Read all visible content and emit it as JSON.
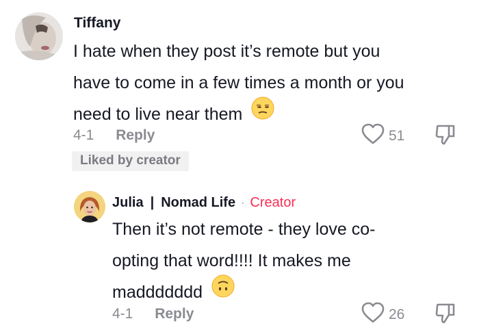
{
  "comment": {
    "author": "Tiffany",
    "text_lines": [
      "I hate when they post it’s remote but you",
      "have to come in a few times a month or you",
      "need to live near them"
    ],
    "emoji": "unamused-face",
    "date": "4-1",
    "reply_label": "Reply",
    "likes": "51",
    "liked_badge": "Liked by creator"
  },
  "reply": {
    "author_first": "Julia",
    "separator": "|",
    "author_second": "Nomad Life",
    "dot": "·",
    "role": "Creator",
    "text_lines": [
      "Then it’s not remote - they love co-",
      "opting that word!!!! It makes me",
      "maddddddd"
    ],
    "emoji": "upside-down-face",
    "date": "4-1",
    "reply_label": "Reply",
    "likes": "26"
  },
  "colors": {
    "text": "#161823",
    "muted": "#8a8b91",
    "creator": "#fe2c55",
    "badge_bg": "#f1f1f2"
  }
}
